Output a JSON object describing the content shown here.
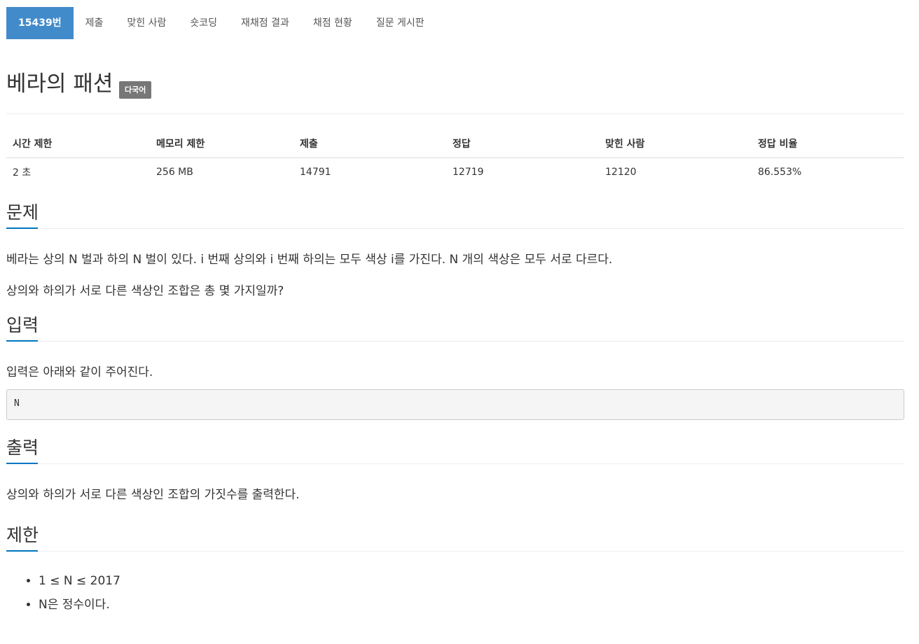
{
  "tabs": [
    {
      "label": "15439번",
      "active": true
    },
    {
      "label": "제출"
    },
    {
      "label": "맞힌 사람"
    },
    {
      "label": "숏코딩"
    },
    {
      "label": "재채점 결과"
    },
    {
      "label": "채점 현황"
    },
    {
      "label": "질문 게시판"
    }
  ],
  "problem": {
    "title": "베라의 패션",
    "badge": "다국어"
  },
  "info_table": {
    "headers": [
      "시간 제한",
      "메모리 제한",
      "제출",
      "정답",
      "맞힌 사람",
      "정답 비율"
    ],
    "values": [
      "2 초",
      "256 MB",
      "14791",
      "12719",
      "12120",
      "86.553%"
    ]
  },
  "sections": {
    "description": {
      "title": "문제",
      "paragraphs": [
        "베라는 상의 N 벌과 하의 N 벌이 있다. i 번째 상의와 i 번째 하의는 모두 색상 i를 가진다. N 개의 색상은 모두 서로 다르다.",
        "상의와 하의가 서로 다른 색상인 조합은 총 몇 가지일까?"
      ]
    },
    "input": {
      "title": "입력",
      "paragraph": "입력은 아래와 같이 주어진다.",
      "code": "N"
    },
    "output": {
      "title": "출력",
      "paragraph": "상의와 하의가 서로 다른 색상인 조합의 가짓수를 출력한다."
    },
    "limits": {
      "title": "제한",
      "items": [
        "1 ≤ N ≤ 2017",
        "N은 정수이다."
      ]
    }
  },
  "colors": {
    "accent": "#428bca",
    "section_underline": "#0076c0",
    "badge_bg": "#777777"
  }
}
